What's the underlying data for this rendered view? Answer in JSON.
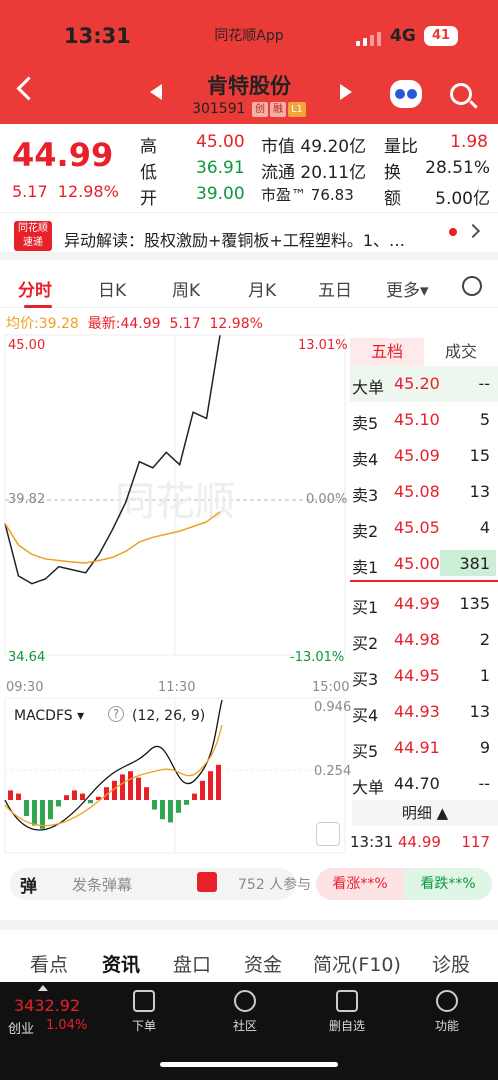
{
  "status_bar": {
    "time": "13:31",
    "network": "4G",
    "battery": "41"
  },
  "app_name": "同花顺App",
  "stock": {
    "name": "肯特股份",
    "code": "301591",
    "tags": [
      "创",
      "融",
      "L1"
    ]
  },
  "quote": {
    "price": "44.99",
    "change": "5.17",
    "change_pct": "12.98%",
    "high_label": "高",
    "high": "45.00",
    "low_label": "低",
    "low": "36.91",
    "open_label": "开",
    "open": "39.00",
    "mcap_label": "市值",
    "mcap": "49.20亿",
    "float_label": "流通",
    "float": "20.11亿",
    "pe_label": "市盈™",
    "pe": "76.83",
    "vr_label": "量比",
    "vr": "1.98",
    "turn_label": "换",
    "turn": "28.51%",
    "amt_label": "额",
    "amt": "5.00亿"
  },
  "news": {
    "logo": "同花顺 速递",
    "text": "异动解读：股权激励+覆铜板+工程塑料。1、…"
  },
  "tabs": [
    "分时",
    "日K",
    "周K",
    "月K",
    "五日",
    "更多▾"
  ],
  "info_bar": {
    "avg_label": "均价:",
    "avg": "39.28",
    "latest_label": "最新:",
    "latest": "44.99",
    "chg": "5.17",
    "pct": "12.98%"
  },
  "chart_labels": {
    "top_price": "45.00",
    "top_pct": "13.01%",
    "mid_price": "39.82",
    "mid_pct": "0.00%",
    "bot_price": "34.64",
    "bot_pct": "-13.01%",
    "t_start": "09:30",
    "t_mid": "11:30",
    "t_end": "15:00"
  },
  "macd": {
    "indicator": "MACDFS ▾",
    "help": "?",
    "params": "(12, 26, 9)",
    "top": "0.946",
    "mid": "0.254"
  },
  "chart_data": {
    "type": "line",
    "x": [
      "09:30",
      "09:40",
      "09:50",
      "10:00",
      "10:10",
      "10:20",
      "10:30",
      "10:40",
      "10:50",
      "11:00",
      "11:10",
      "11:20",
      "11:30",
      "13:00",
      "13:10",
      "13:20",
      "13:31"
    ],
    "series": [
      {
        "values": [
          38.9,
          37.2,
          36.95,
          37.1,
          37.5,
          37.4,
          37.3,
          37.9,
          38.7,
          39.6,
          40.9,
          40.7,
          41.2,
          40.8,
          42.5,
          42.3,
          44.99
        ]
      },
      {
        "values": [
          38.9,
          38.2,
          37.9,
          37.75,
          37.7,
          37.65,
          37.62,
          37.7,
          37.8,
          38.0,
          38.3,
          38.45,
          38.55,
          38.65,
          38.8,
          38.95,
          39.28
        ]
      }
    ],
    "ylim": [
      34.64,
      45.0
    ],
    "baseline": 39.82
  },
  "orderbook": {
    "tabs": [
      "五档",
      "成交"
    ],
    "big_sell": {
      "label": "大单",
      "price": "45.20",
      "vol": "--"
    },
    "sell": [
      {
        "label": "卖5",
        "price": "45.10",
        "vol": "5"
      },
      {
        "label": "卖4",
        "price": "45.09",
        "vol": "15"
      },
      {
        "label": "卖3",
        "price": "45.08",
        "vol": "13"
      },
      {
        "label": "卖2",
        "price": "45.05",
        "vol": "4"
      },
      {
        "label": "卖1",
        "price": "45.00",
        "vol": "381"
      }
    ],
    "buy": [
      {
        "label": "买1",
        "price": "44.99",
        "vol": "135"
      },
      {
        "label": "买2",
        "price": "44.98",
        "vol": "2"
      },
      {
        "label": "买3",
        "price": "44.95",
        "vol": "1"
      },
      {
        "label": "买4",
        "price": "44.93",
        "vol": "13"
      },
      {
        "label": "买5",
        "price": "44.91",
        "vol": "9"
      }
    ],
    "big_buy": {
      "label": "大单",
      "price": "44.70",
      "vol": "--"
    },
    "detail": "明细 ▲",
    "tick": {
      "time": "13:31",
      "price": "44.99",
      "vol": "117"
    }
  },
  "barrage": {
    "icon": "弹",
    "placeholder": "发条弹幕",
    "participants": "752 人参与",
    "up": "看涨**%",
    "down": "看跌**%"
  },
  "bottom_tabs": [
    "看点",
    "资讯",
    "盘口",
    "资金",
    "简况(F10)",
    "诊股"
  ],
  "dock": {
    "index": "3432.92",
    "index_name": "创业",
    "index_pct": "1.04%",
    "items": [
      "下单",
      "社区",
      "删自选",
      "功能"
    ]
  },
  "colors": {
    "red": "#e8202a",
    "green": "#0a9a3c",
    "header": "#ea3b38"
  }
}
